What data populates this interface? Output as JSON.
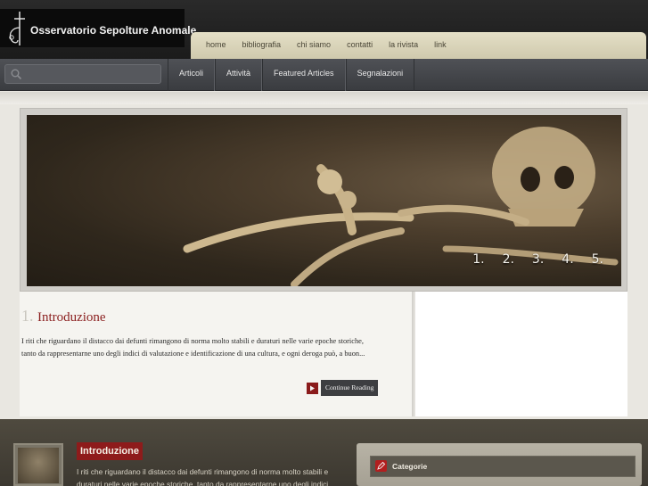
{
  "site": {
    "logo_text": "Osservatorio Sepolture Anomale"
  },
  "top_nav": [
    "home",
    "bibliografia",
    "chi siamo",
    "contatti",
    "la rivista",
    "link"
  ],
  "search": {
    "placeholder": "",
    "icon": "search-icon"
  },
  "main_nav": [
    "Articoli",
    "Attività",
    "Featured Articles",
    "Segnalazioni"
  ],
  "slider": {
    "pages": [
      "1.",
      "2.",
      "3.",
      "4.",
      "5."
    ]
  },
  "article": {
    "number": "1.",
    "title": "Introduzione",
    "excerpt": "I riti che riguardano il distacco dai defunti rimangono di norma molto stabili e duraturi nelle varie epoche storiche, tanto da rappresentarne uno degli indici di valutazione e identificazione di una cultura, e ogni deroga può, a buon...",
    "continue_label": "Continue Reading"
  },
  "bottom": {
    "title": "Introduzione",
    "excerpt": "I riti che riguardano il distacco dai defunti rimangono di norma molto stabili e duraturi nelle varie epoche storiche, tanto da rappresentarne uno degli indici",
    "categories_label": "Categorie"
  },
  "colors": {
    "accent": "#8b1f1f",
    "nav_bg": "#44464a",
    "top_nav_bg": "#dcd6bb"
  }
}
